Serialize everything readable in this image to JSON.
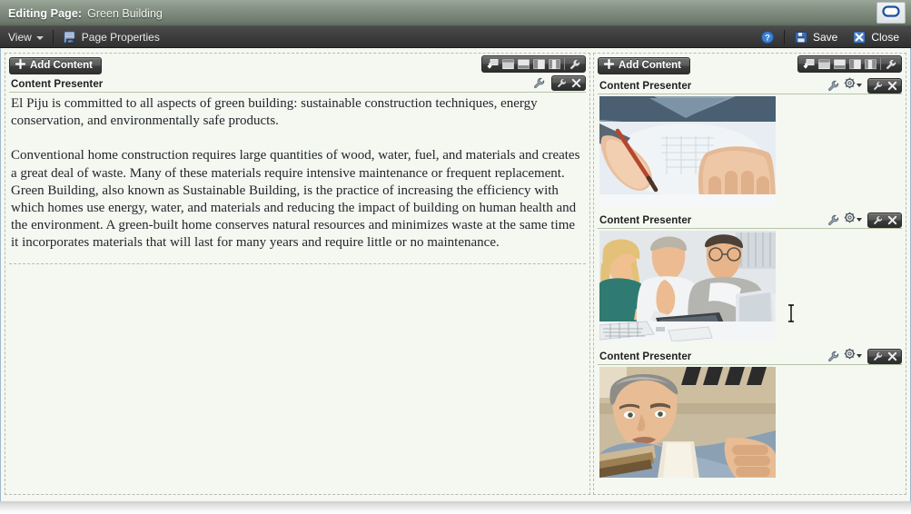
{
  "titlebar": {
    "label": "Editing Page:",
    "page_name": "Green Building",
    "monitor_icon": "monitor-icon"
  },
  "menubar": {
    "view_label": "View",
    "page_properties_label": "Page Properties",
    "help_label": "?",
    "save_label": "Save",
    "close_label": "Close"
  },
  "regions": {
    "left": {
      "add_content_label": "Add Content",
      "layout_icons": [
        "add-box-icon",
        "layout-one-column-icon",
        "layout-two-row-icon",
        "layout-two-column-icon",
        "layout-three-column-icon",
        "wrench-icon"
      ],
      "taskflows": [
        {
          "title": "Content Presenter",
          "actions": [
            "wrench-icon",
            "edit-wrench-icon",
            "close-x-icon"
          ],
          "paragraphs": [
            "El Piju is committed to all aspects of green building: sustainable construction techniques, energy conservation, and environmentally safe products.",
            "Conventional home construction requires large quantities of wood, water, fuel, and materials and creates a great deal of waste. Many of these materials require intensive maintenance or frequent replacement. Green Building, also known as Sustainable Building,  is the practice of increasing the efficiency with which homes use energy, water, and materials and reducing the impact of building on human health and the environment. A green-built home conserves natural resources and minimizes waste at the same time it incorporates materials that will last for many years and require little or no maintenance."
          ]
        }
      ]
    },
    "right": {
      "add_content_label": "Add Content",
      "layout_icons": [
        "add-box-icon",
        "layout-one-column-icon",
        "layout-two-row-icon",
        "layout-two-column-icon",
        "layout-three-column-icon",
        "wrench-icon"
      ],
      "taskflows": [
        {
          "title": "Content Presenter",
          "actions": [
            "wrench-icon",
            "gear-icon",
            "edit-wrench-icon",
            "close-x-icon"
          ],
          "image_alt": "architect-hand-drawing-blueprint-photo"
        },
        {
          "title": "Content Presenter",
          "actions": [
            "wrench-icon",
            "gear-icon",
            "edit-wrench-icon",
            "close-x-icon"
          ],
          "image_alt": "business-team-meeting-with-laptop-photo"
        },
        {
          "title": "Content Presenter",
          "actions": [
            "wrench-icon",
            "gear-icon",
            "edit-wrench-icon",
            "close-x-icon"
          ],
          "image_alt": "carpenter-sighting-along-board-photo"
        }
      ]
    }
  },
  "cursor": {
    "type": "text-ibeam-cursor"
  },
  "colors": {
    "titlebar": "#7d8a7c",
    "menubar": "#3f3f3f",
    "canvas": "#f4f8f1",
    "frame_border": "#9fb8c8",
    "region_border": "#b9b9b9",
    "accent_blue": "#2a5db0"
  }
}
